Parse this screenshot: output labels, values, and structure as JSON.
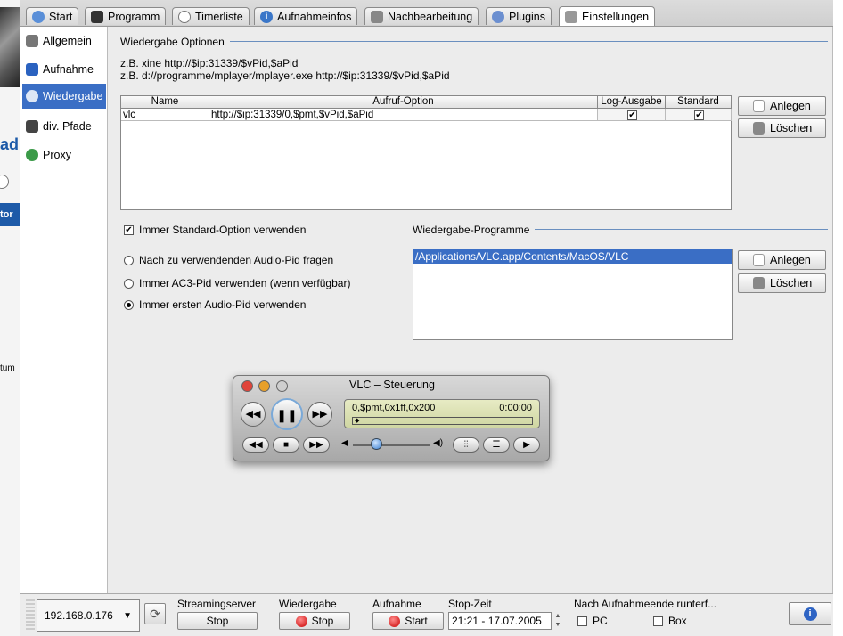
{
  "tabs": [
    {
      "label": "Start",
      "icon": "home-icon"
    },
    {
      "label": "Programm",
      "icon": "tv-icon"
    },
    {
      "label": "Timerliste",
      "icon": "clock-icon"
    },
    {
      "label": "Aufnahmeinfos",
      "icon": "info-icon"
    },
    {
      "label": "Nachbearbeitung",
      "icon": "tools-icon"
    },
    {
      "label": "Plugins",
      "icon": "plugin-icon"
    },
    {
      "label": "Einstellungen",
      "icon": "wrench-icon"
    }
  ],
  "sidebar": {
    "items": [
      {
        "label": "Allgemein",
        "icon": "tools-icon"
      },
      {
        "label": "Aufnahme",
        "icon": "clapper-icon"
      },
      {
        "label": "Wiedergabe",
        "icon": "eye-icon",
        "selected": true
      },
      {
        "label": "div. Pfade",
        "icon": "disk-icon"
      },
      {
        "label": "Proxy",
        "icon": "globe-icon"
      }
    ]
  },
  "background_app": {
    "frag1": "ad",
    "frag2": "tor",
    "frag3": "tum"
  },
  "playback": {
    "section_title": "Wiedergabe Optionen",
    "example1": "z.B. xine http://$ip:31339/$vPid,$aPid",
    "example2": "z.B. d://programme/mplayer/mplayer.exe http://$ip:31339/$vPid,$aPid",
    "table": {
      "headers": [
        "Name",
        "Aufruf-Option",
        "Log-Ausgabe",
        "Standard"
      ],
      "rows": [
        {
          "name": "vlc",
          "option": "http://$ip:31339/0,$pmt,$vPid,$aPid",
          "log": true,
          "standard": true
        }
      ]
    },
    "btn_add": "Anlegen",
    "btn_delete": "Löschen",
    "use_standard": "Immer Standard-Option verwenden",
    "use_standard_checked": true,
    "radio_options": [
      {
        "label": "Nach zu verwendenden Audio-Pid fragen",
        "selected": false
      },
      {
        "label": "Immer AC3-Pid verwenden (wenn verfügbar)",
        "selected": false
      },
      {
        "label": "Immer ersten Audio-Pid verwenden",
        "selected": true
      }
    ],
    "programs_title": "Wiedergabe-Programme",
    "programs": [
      "/Applications/VLC.app/Contents/MacOS/VLC"
    ]
  },
  "vlc": {
    "title": "VLC – Steuerung",
    "stream": "0,$pmt,0x1ff,0x200",
    "time": "0:00:00",
    "volume_level": 0.3
  },
  "bottom": {
    "ip": "192.168.0.176",
    "streaming_label": "Streamingserver",
    "streaming_btn": "Stop",
    "playback_label": "Wiedergabe",
    "playback_btn": "Stop",
    "record_label": "Aufnahme",
    "record_btn": "Start",
    "stoptime_label": "Stop-Zeit",
    "stoptime_value": "21:21 - 17.07.2005",
    "after_label": "Nach Aufnahmeende runterf...",
    "pc_label": "PC",
    "box_label": "Box"
  },
  "colors": {
    "selection": "#3a6ec5",
    "rule": "#6a8fbf",
    "lcd": "#dde2b4"
  }
}
